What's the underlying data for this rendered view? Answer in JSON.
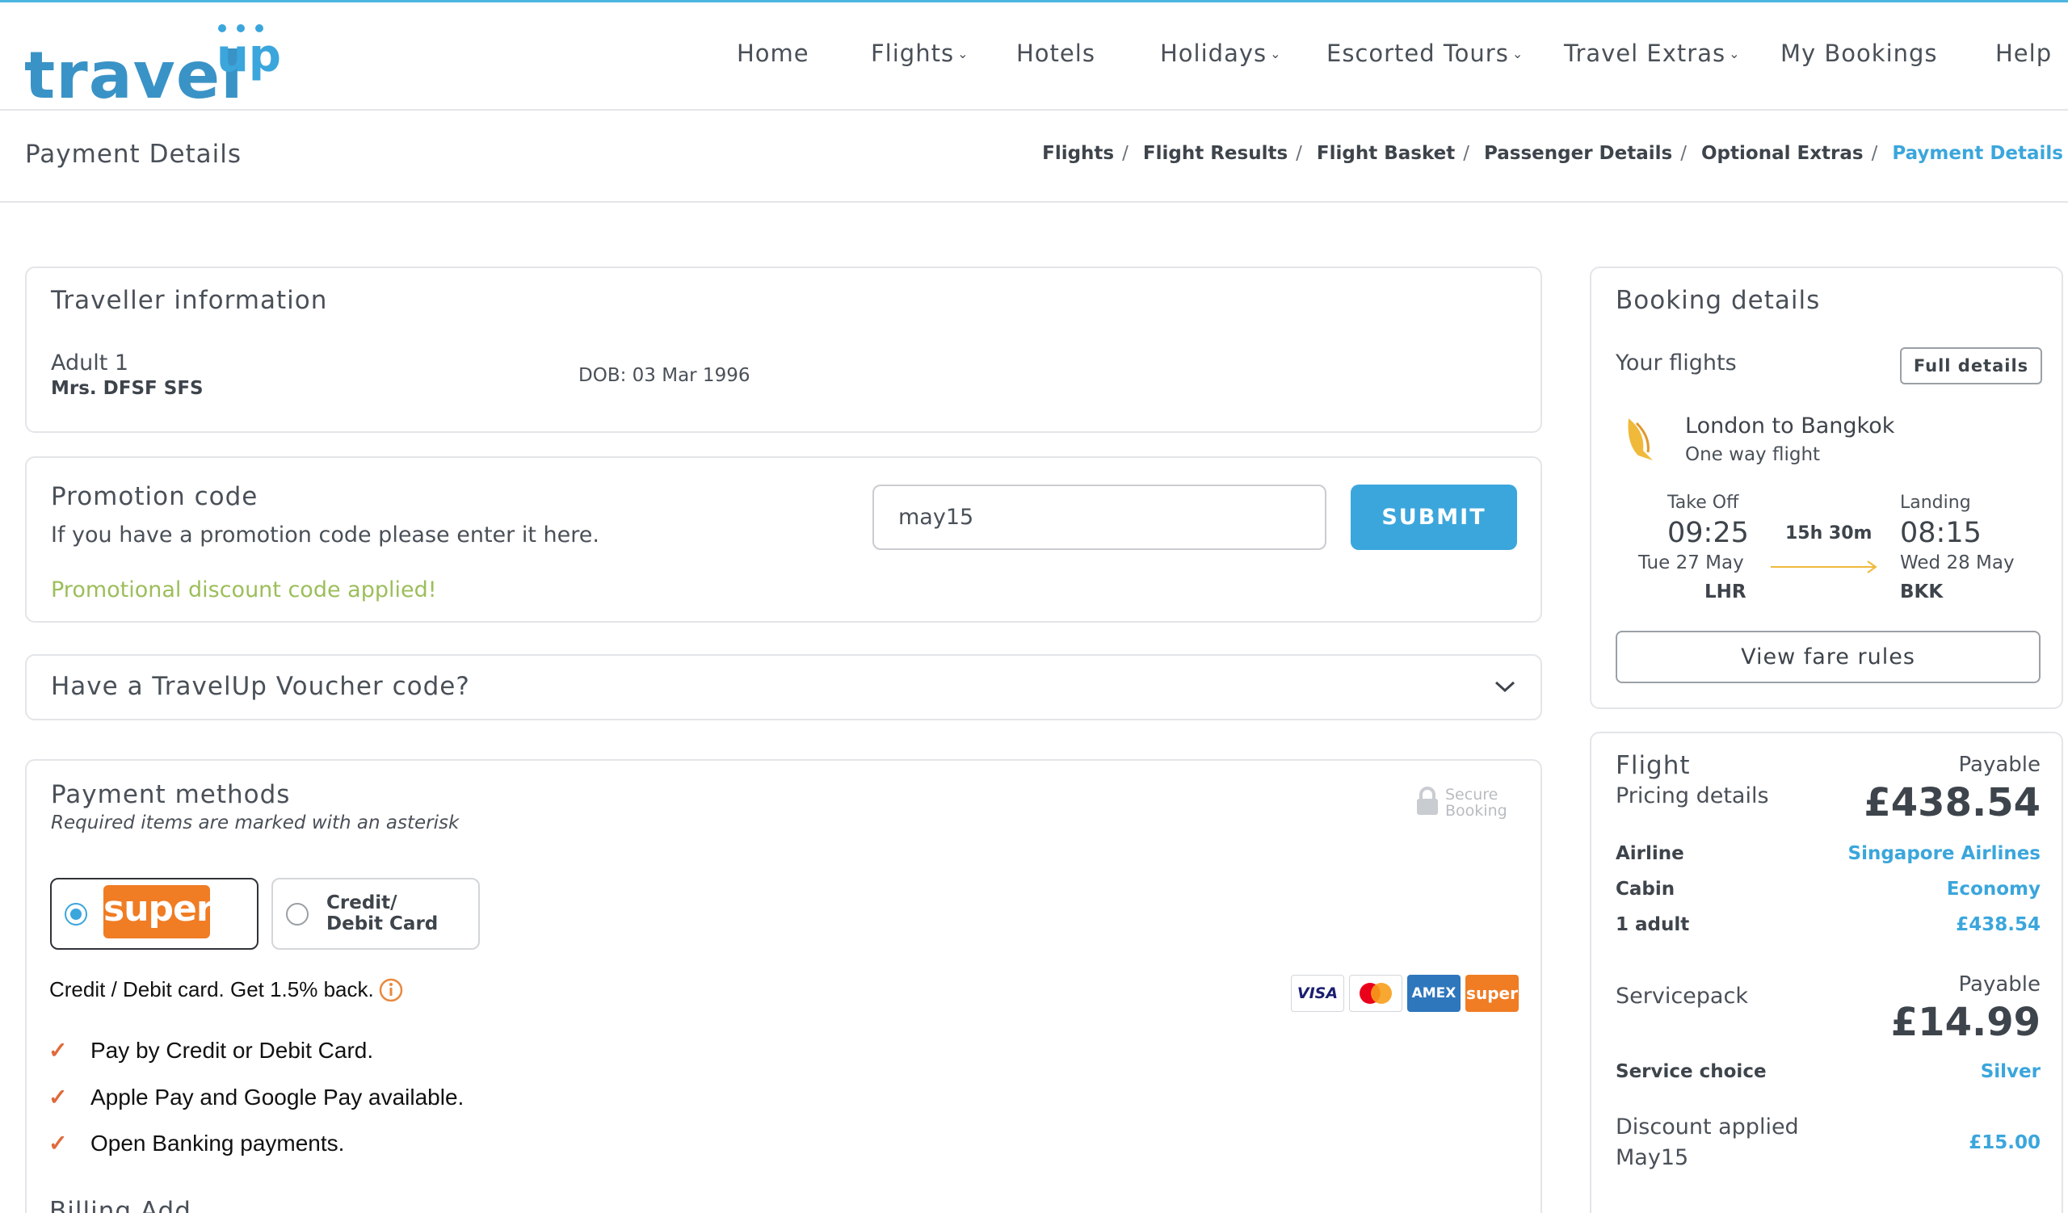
{
  "colors": {
    "accent": "#3ba6dc",
    "brand_super": "#f07c24",
    "success": "#9cbe5a",
    "check": "#e06a3c"
  },
  "logo": {
    "main": "travel",
    "sup": "up"
  },
  "nav": [
    {
      "label": "Home",
      "dropdown": false
    },
    {
      "label": "Flights",
      "dropdown": true
    },
    {
      "label": "Hotels",
      "dropdown": false
    },
    {
      "label": "Holidays",
      "dropdown": true
    },
    {
      "label": "Escorted Tours",
      "dropdown": true
    },
    {
      "label": "Travel Extras",
      "dropdown": true
    },
    {
      "label": "My Bookings",
      "dropdown": false
    },
    {
      "label": "Help",
      "dropdown": false
    }
  ],
  "page_title": "Payment Details",
  "breadcrumb": [
    "Flights",
    "Flight Results",
    "Flight Basket",
    "Passenger Details",
    "Optional Extras",
    "Payment Details"
  ],
  "traveller": {
    "title": "Traveller information",
    "adult_label": "Adult 1",
    "name": "Mrs. DFSF SFS",
    "dob": "DOB: 03 Mar 1996"
  },
  "promo": {
    "title": "Promotion code",
    "hint": "If you have a promotion code please enter it here.",
    "value": "may15",
    "submit_label": "SUBMIT",
    "status": "Promotional discount code applied!"
  },
  "voucher": {
    "label": "Have a TravelUp Voucher code?"
  },
  "payment": {
    "title": "Payment methods",
    "subtitle": "Required items are marked with an asterisk",
    "secure_line1": "Secure",
    "secure_line2": "Booking",
    "super_logo": "super",
    "card_option_line1": "Credit/",
    "card_option_line2": "Debit Card",
    "cashback": "Credit / Debit card. Get 1.5% back.",
    "features": [
      "Pay by Credit or Debit Card.",
      "Apple Pay and Google Pay available.",
      "Open Banking payments."
    ],
    "card_logos": [
      "VISA",
      "mastercard",
      "AMEX",
      "super"
    ],
    "billing_heading": "Billing Add"
  },
  "booking": {
    "title": "Booking details",
    "your_flights": "Your flights",
    "full_details": "Full details",
    "route": "London to Bangkok",
    "trip_type": "One way flight",
    "takeoff_label": "Take Off",
    "takeoff_time": "09:25",
    "takeoff_date": "Tue 27 May",
    "takeoff_airport": "LHR",
    "duration": "15h 30m",
    "landing_label": "Landing",
    "landing_time": "08:15",
    "landing_date": "Wed 28 May",
    "landing_airport": "BKK",
    "fare_rules": "View fare rules"
  },
  "pricing": {
    "flight_title": "Flight",
    "pricing_details": "Pricing details",
    "payable_label": "Payable",
    "flight_total": "£438.54",
    "airline_label": "Airline",
    "airline": "Singapore Airlines",
    "cabin_label": "Cabin",
    "cabin": "Economy",
    "adults_label": "1 adult",
    "adults_price": "£438.54",
    "servicepack_title": "Servicepack",
    "servicepack_payable": "Payable",
    "servicepack_total": "£14.99",
    "service_choice_label": "Service choice",
    "service_choice": "Silver",
    "discount_label": "Discount applied",
    "discount_code": "May15",
    "discount_amount": "£15.00"
  }
}
